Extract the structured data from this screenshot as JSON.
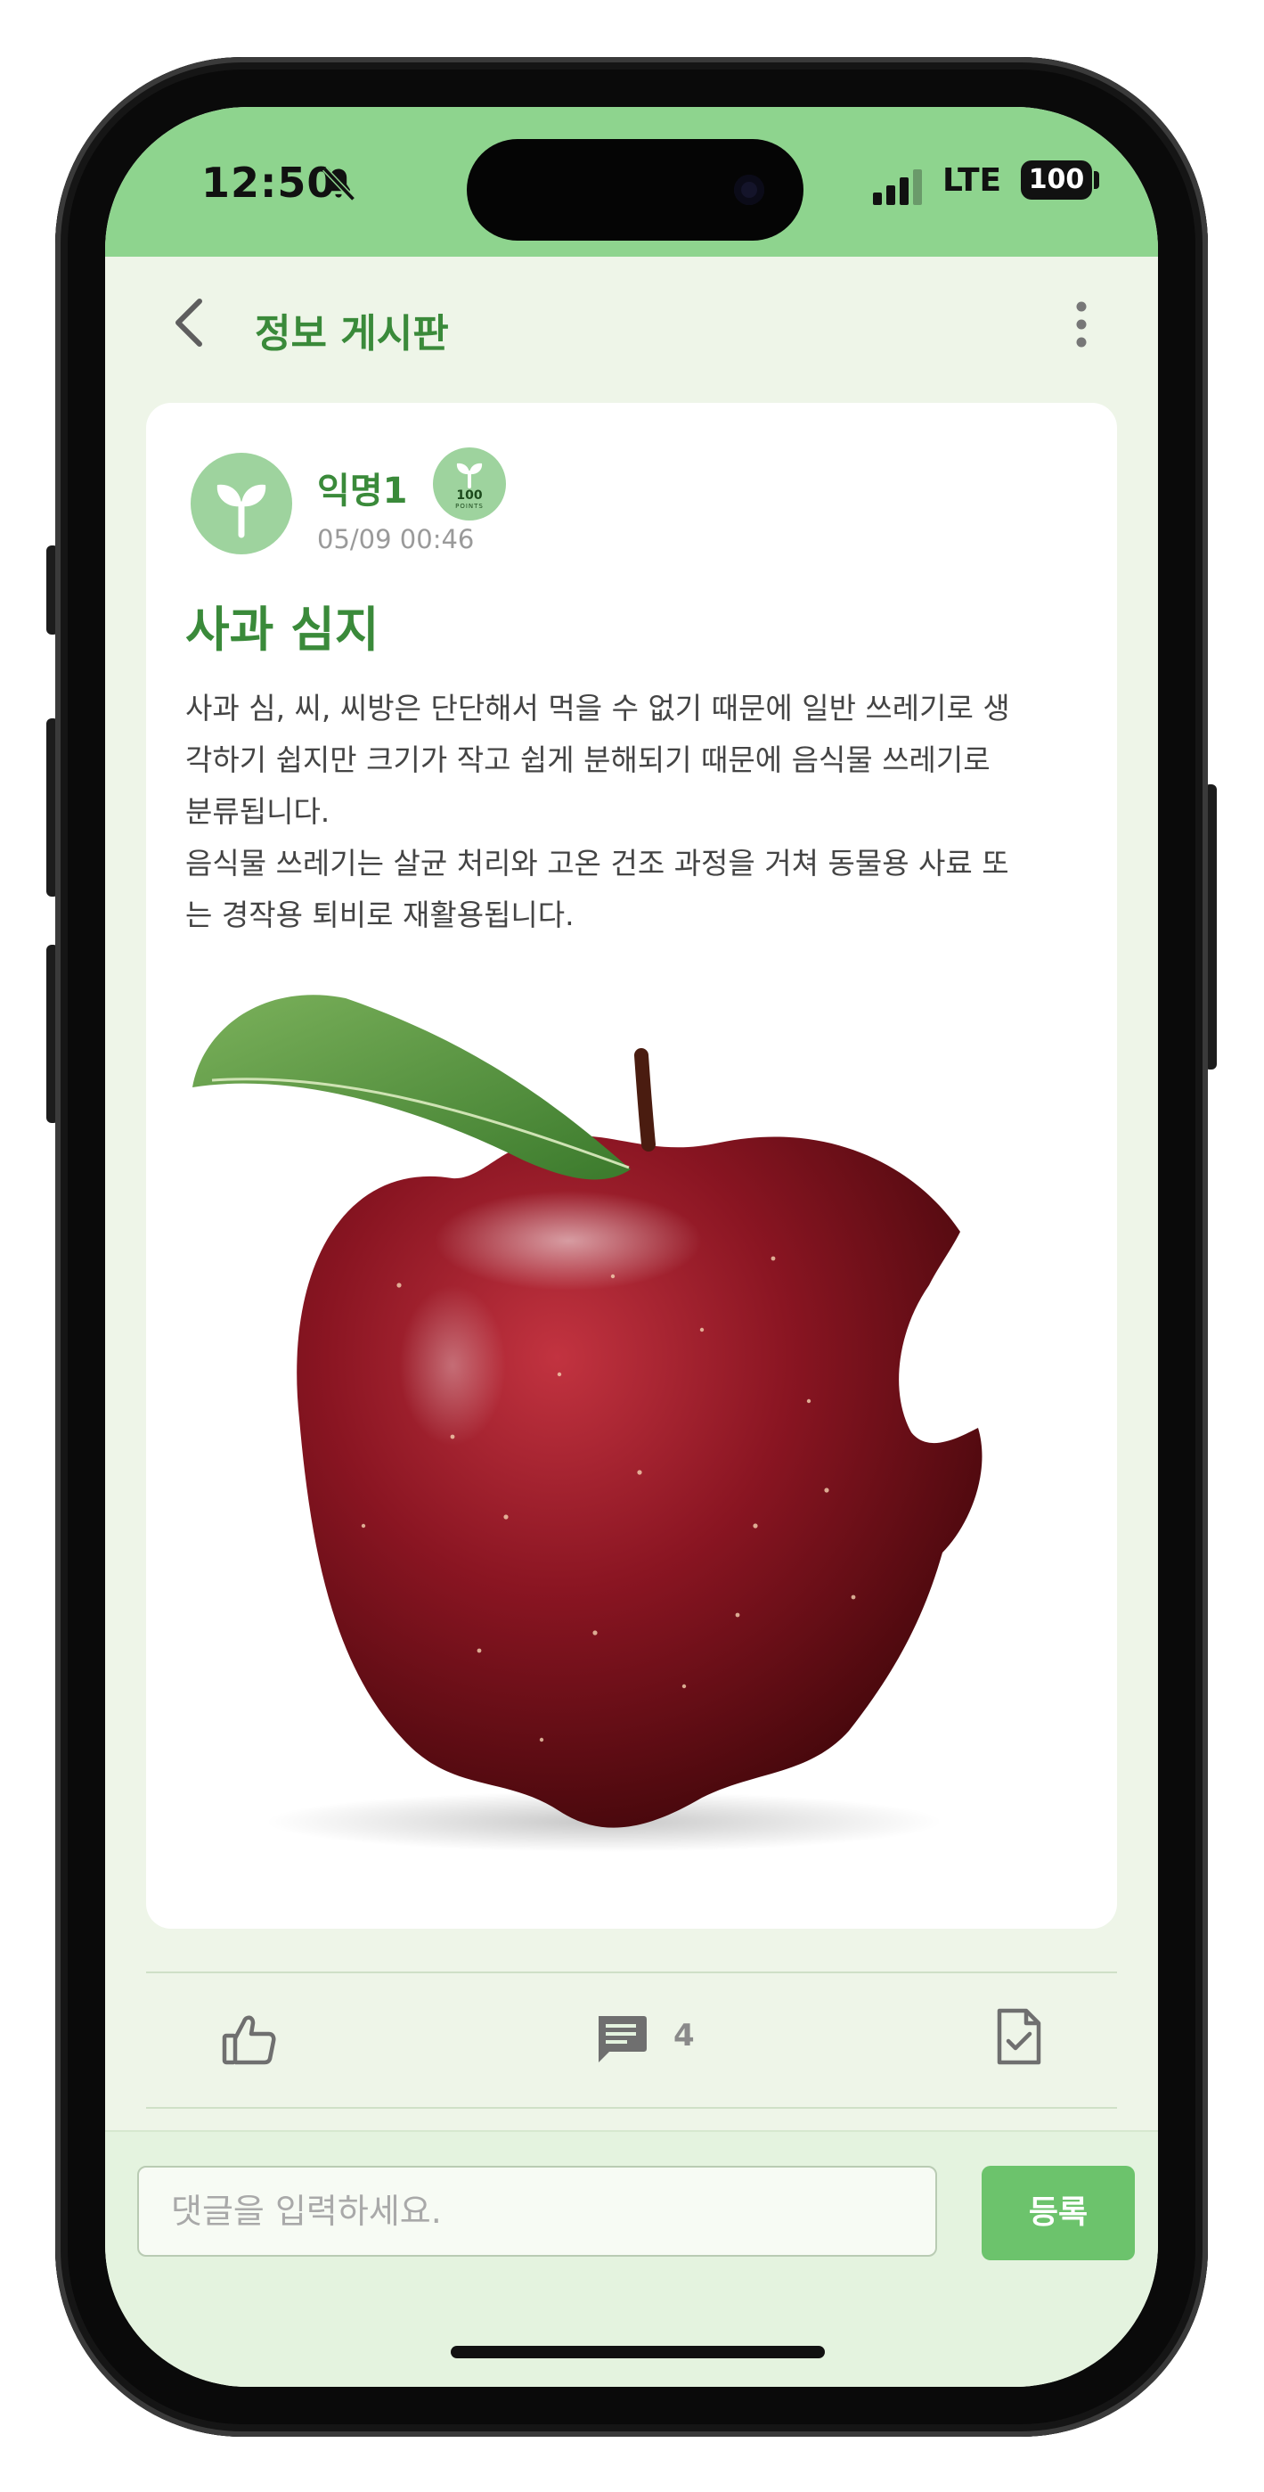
{
  "status_bar": {
    "time": "12:50",
    "network": "LTE",
    "battery": "100",
    "icons": [
      "bell-slash-icon",
      "signal-icon",
      "battery-icon"
    ]
  },
  "header": {
    "title": "정보 게시판",
    "icons": [
      "chevron-left-icon",
      "more-vertical-icon"
    ]
  },
  "post": {
    "author": "익명1",
    "points_badge": {
      "value": "100",
      "unit": "POINTS"
    },
    "date": "05/09 00:46",
    "title": "사과 심지",
    "body_lines": [
      "사과 심, 씨, 씨방은 단단해서 먹을 수 없기 때문에 일반 쓰레기로 생",
      "각하기 쉽지만 크기가 작고 쉽게 분해되기 때문에 음식물 쓰레기로",
      "분류됩니다.",
      "음식물 쓰레기는 살균 처리와 고온 건조 과정을 거쳐 동물용 사료 또",
      "는 경작용 퇴비로 재활용됩니다."
    ],
    "image": "red-apple-with-leaf"
  },
  "actions": {
    "comment_count": "4",
    "icons": [
      "thumbs-up-icon",
      "comment-icon",
      "report-document-icon"
    ]
  },
  "comment_form": {
    "placeholder": "댓글을 입력하세요.",
    "value": "",
    "submit_label": "등록"
  },
  "colors": {
    "status_bar": "#8ed48e",
    "accent_green": "#3a8a3a",
    "button_green": "#6cc36c",
    "page_background": "#eef5e8"
  }
}
